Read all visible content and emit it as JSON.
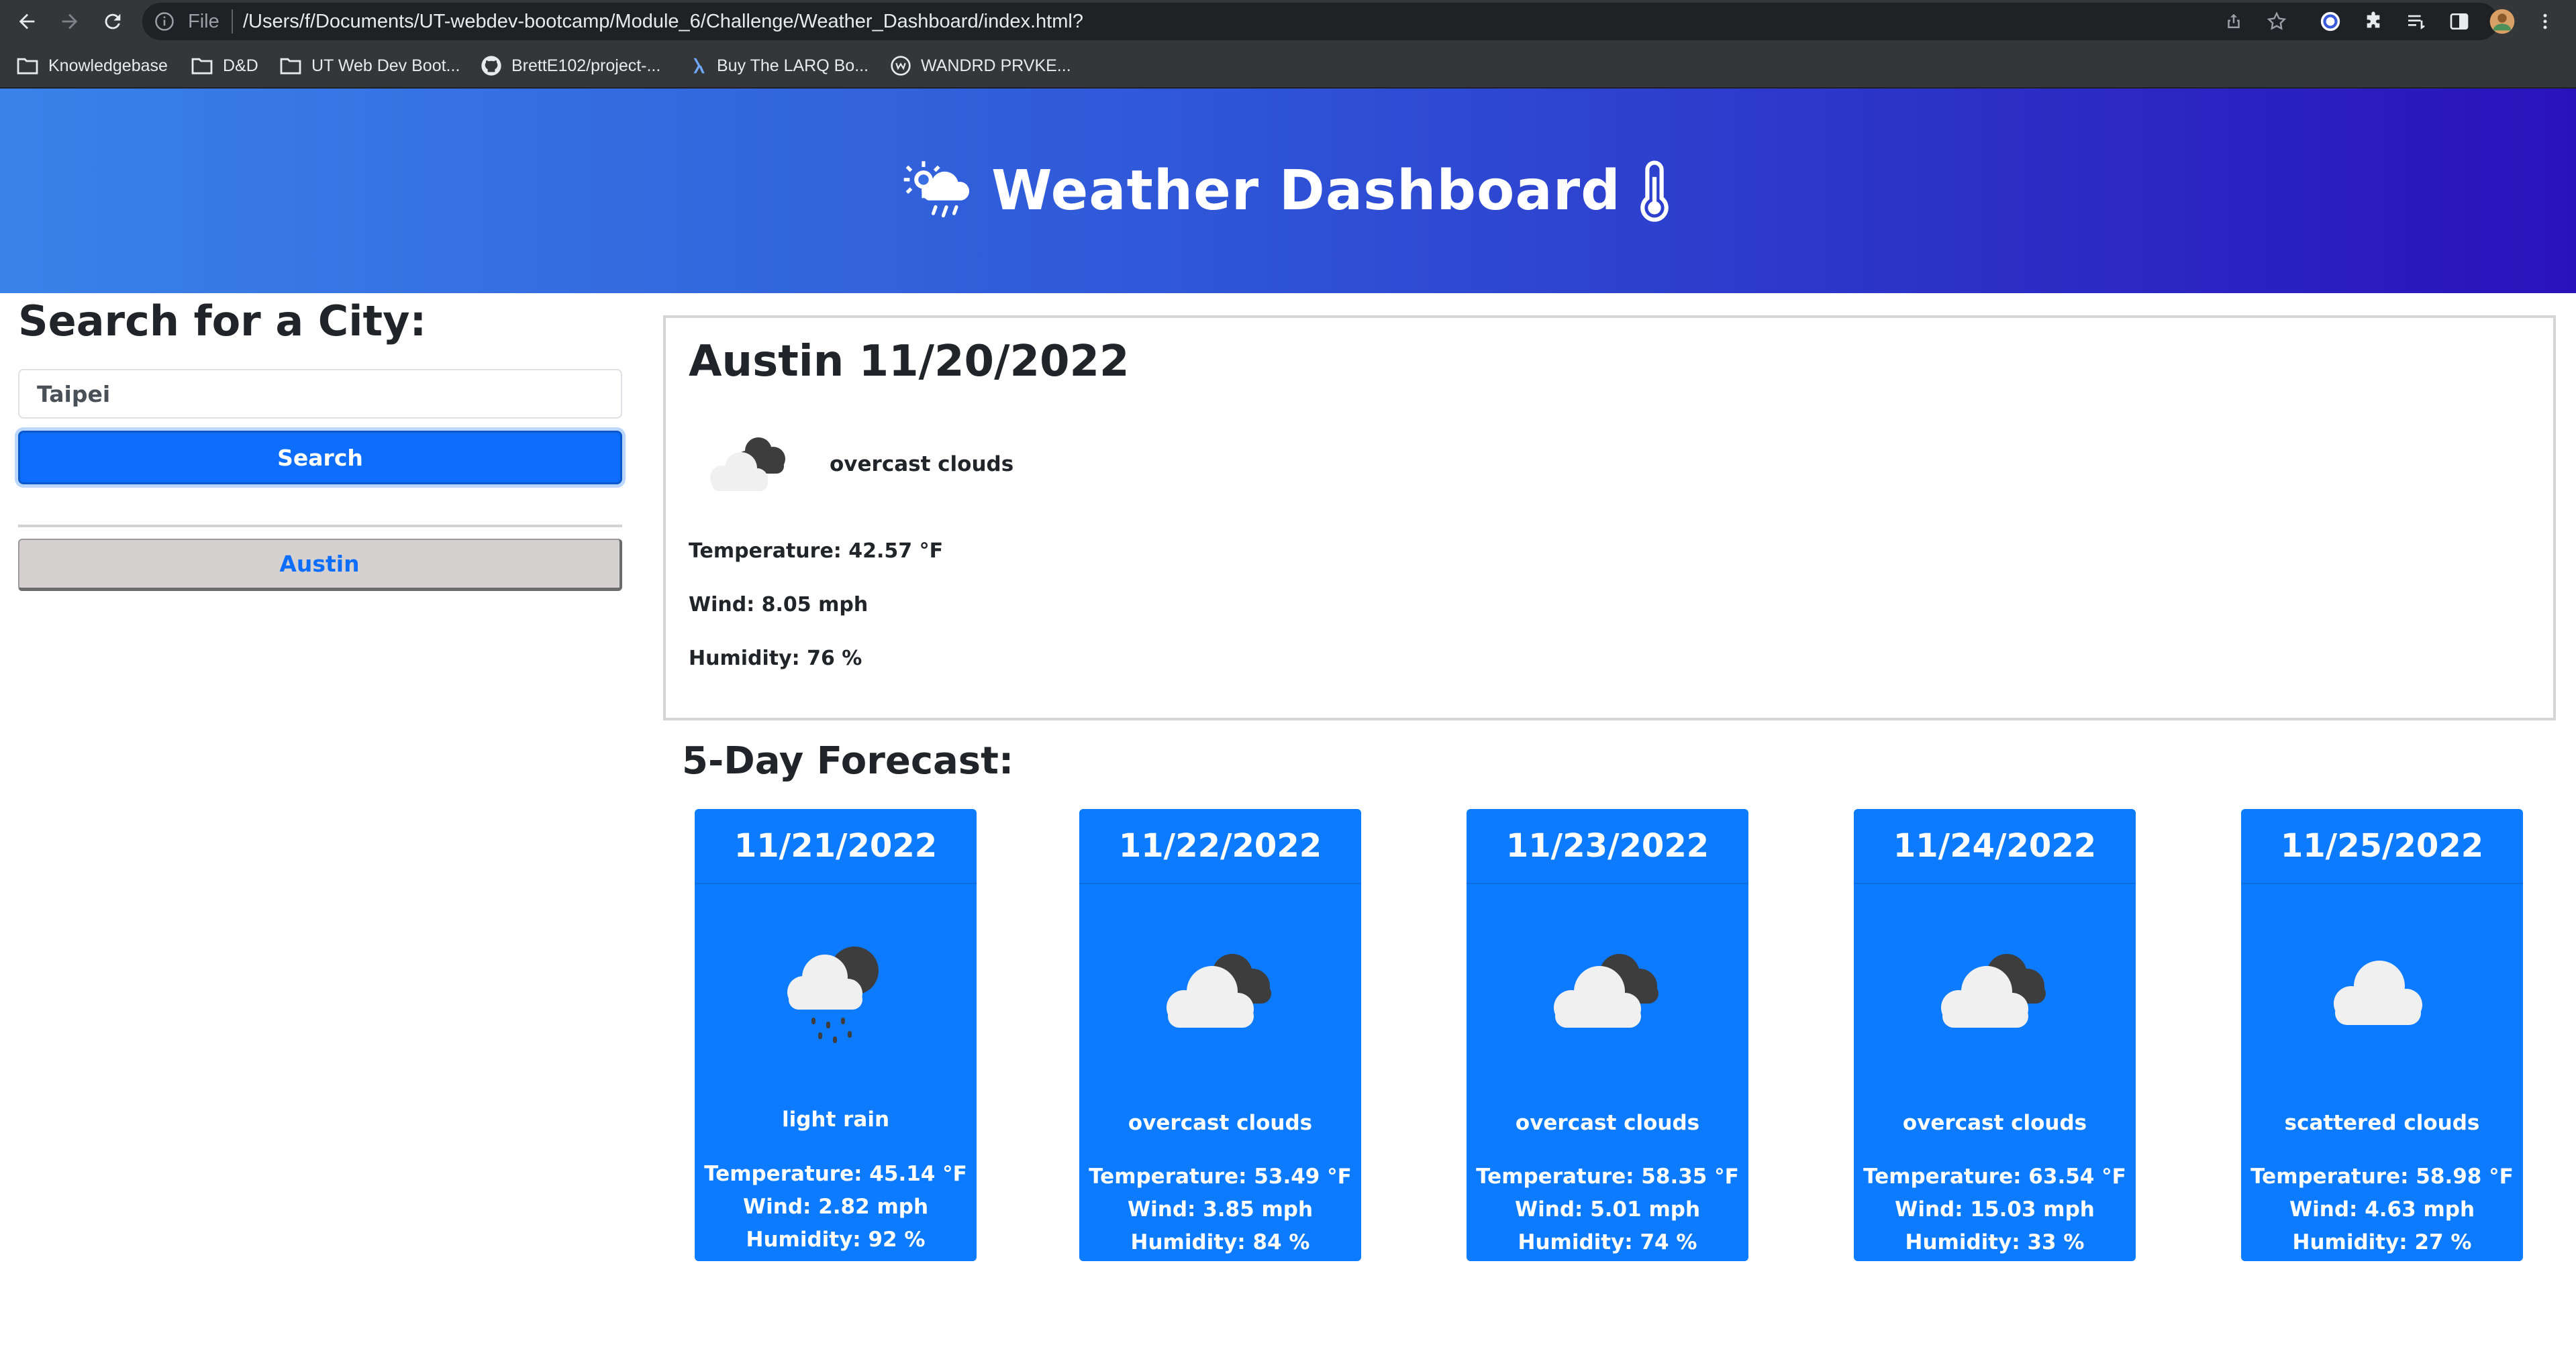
{
  "browser": {
    "file_label": "File",
    "url": "/Users/f/Documents/UT-webdev-bootcamp/Module_6/Challenge/Weather_Dashboard/index.html?",
    "bookmarks": [
      {
        "label": "Knowledgebase",
        "icon": "folder-icon"
      },
      {
        "label": "D&D",
        "icon": "folder-icon"
      },
      {
        "label": "UT Web Dev Boot...",
        "icon": "folder-icon"
      },
      {
        "label": "BrettE102/project-...",
        "icon": "github-icon"
      },
      {
        "label": "Buy The LARQ Bo...",
        "icon": "larq-icon"
      },
      {
        "label": "WANDRD PRVKE...",
        "icon": "wandrd-icon"
      }
    ]
  },
  "header": {
    "title": "Weather Dashboard",
    "left_icon": "sun-cloud-rain-icon",
    "right_icon": "thermometer-icon",
    "gradient_start": "#3a82e8",
    "gradient_end": "#2a12ba"
  },
  "search": {
    "heading": "Search for a City:",
    "input_value": "Taipei",
    "button_label": "Search",
    "history": [
      "Austin"
    ],
    "accent": "#0d6efd"
  },
  "current": {
    "title": "Austin 11/20/2022",
    "icon": "overcast-clouds-icon",
    "description": "overcast clouds",
    "temperature": "Temperature: 42.57 °F",
    "wind": "Wind: 8.05 mph",
    "humidity": "Humidity: 76 %"
  },
  "forecast": {
    "heading": "5-Day Forecast:",
    "card_color": "#0d7bff",
    "days": [
      {
        "date": "11/21/2022",
        "icon": "light-rain-icon",
        "description": "light rain",
        "temperature": "Temperature: 45.14 °F",
        "wind": "Wind: 2.82 mph",
        "humidity": "Humidity: 92 %"
      },
      {
        "date": "11/22/2022",
        "icon": "overcast-clouds-icon",
        "description": "overcast clouds",
        "temperature": "Temperature: 53.49 °F",
        "wind": "Wind: 3.85 mph",
        "humidity": "Humidity: 84 %"
      },
      {
        "date": "11/23/2022",
        "icon": "overcast-clouds-icon",
        "description": "overcast clouds",
        "temperature": "Temperature: 58.35 °F",
        "wind": "Wind: 5.01 mph",
        "humidity": "Humidity: 74 %"
      },
      {
        "date": "11/24/2022",
        "icon": "overcast-clouds-icon",
        "description": "overcast clouds",
        "temperature": "Temperature: 63.54 °F",
        "wind": "Wind: 15.03 mph",
        "humidity": "Humidity: 33 %"
      },
      {
        "date": "11/25/2022",
        "icon": "scattered-clouds-icon",
        "description": "scattered clouds",
        "temperature": "Temperature: 58.98 °F",
        "wind": "Wind: 4.63 mph",
        "humidity": "Humidity: 27 %"
      }
    ]
  }
}
